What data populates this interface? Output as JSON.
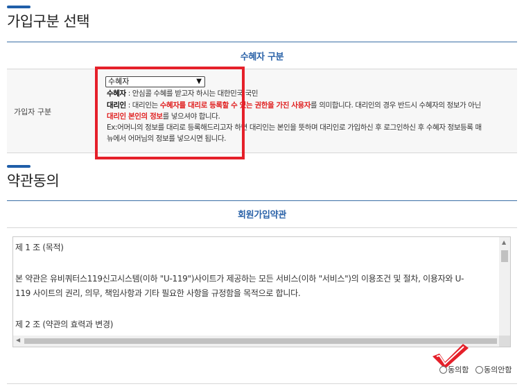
{
  "sections": {
    "signup_type": {
      "title": "가입구분 선택",
      "caption": "수혜자 구분",
      "row_label": "가입자 구분",
      "select_value": "수혜자",
      "desc": {
        "line1_bold": "수혜자",
        "line1_rest": " : 안심콜 수혜를 받고자 하시는 대한민국 국민",
        "line2_bold": "대리인",
        "line2_pre": " : 대리인는 ",
        "line2_red": "수혜자를 대리로 등록할 수 있는 권한을 가진 사용자",
        "line2_post": "를 의미합니다. 대리인의 경우 반드시 수혜자의 정보가 아닌",
        "line3_red": "대리인 본인의 정보",
        "line3_rest": "를 넣으셔야 합니다.",
        "line4": "Ex:어머니의 정보를 대리로 등록해드리고자 하면 대리인는 본인을 뜻하며 대리인로 가입하신 후 로그인하신 후 수혜자 정보등록 매",
        "line5": "뉴에서 어머님의 정보를 넣으시면 됩니다."
      }
    },
    "terms": {
      "title": "약관동의",
      "caption": "회원가입약관",
      "lines": [
        "제 1 조 (목적)",
        "본 약관은 유비쿼터스119신고시스템(이하 \"U-119\")사이트가 제공하는 모든 서비스(이하 \"서비스\")의 이용조건 및 절차, 이용자와 U-",
        "119 사이트의 권리, 의무, 책임사항과 기타 필요한 사항을 규정함을 목적으로 합니다.",
        "제 2 조 (약관의 효력과 변경)"
      ],
      "agree_label": "동의함",
      "disagree_label": "동의안함"
    }
  },
  "colors": {
    "accent_blue": "#1f5ea8",
    "highlight_red": "#e5202a"
  }
}
